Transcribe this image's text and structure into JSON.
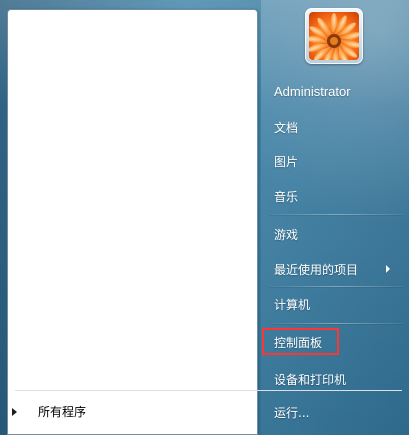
{
  "left_panel": {
    "all_programs_label": "所有程序"
  },
  "right_panel": {
    "user_name": "Administrator",
    "items": [
      {
        "label": "文档"
      },
      {
        "label": "图片"
      },
      {
        "label": "音乐"
      },
      {
        "label": "游戏"
      },
      {
        "label": "最近使用的项目"
      },
      {
        "label": "计算机"
      },
      {
        "label": "控制面板"
      },
      {
        "label": "设备和打印机"
      },
      {
        "label": "运行..."
      }
    ]
  },
  "icons": {
    "all_programs": "play-triangle-icon",
    "recent_items_submenu": "chevron-right-icon",
    "user_picture": "orange-flower-user-picture"
  },
  "colors": {
    "menu_background": "#3e83a8",
    "left_pane_background": "#ffffff",
    "right_text": "#ffffff",
    "highlight": "#ff3434"
  },
  "highlight": {
    "target_label": "控制面板"
  }
}
